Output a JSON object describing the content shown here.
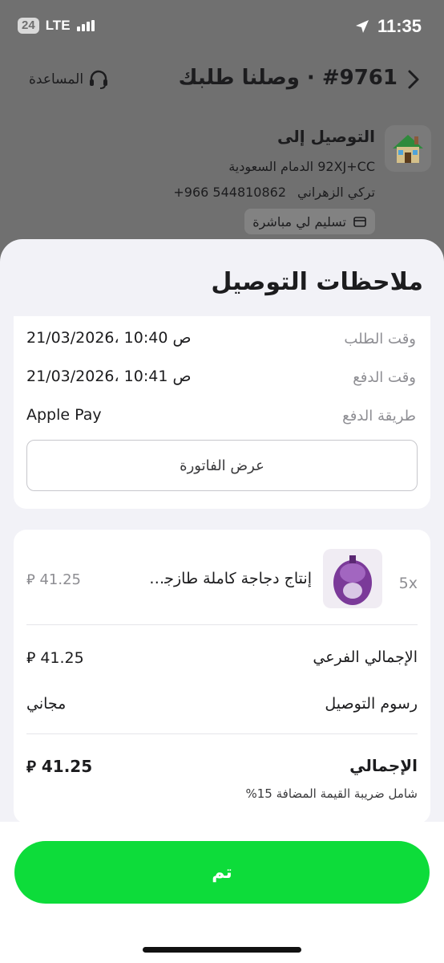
{
  "status_bar": {
    "badge": "24",
    "network": "LTE",
    "time": "11:35"
  },
  "header": {
    "title": "#9761 · وصلنا طلبك",
    "help_label": "المساعدة"
  },
  "delivery": {
    "title": "التوصيل إلى",
    "address": "92XJ+CC الدمام السعودية",
    "name": "تركي الزهراني",
    "phone": "+966 544810862",
    "chip_label": "تسليم لي مباشرة"
  },
  "sheet": {
    "title": "ملاحظات التوصيل",
    "info_rows": [
      {
        "label": "وقت الطلب",
        "value": "21/03/2026، 10:40 ص"
      },
      {
        "label": "وقت الدفع",
        "value": "21/03/2026، 10:41 ص"
      },
      {
        "label": "طريقة الدفع",
        "value": "Apple Pay"
      }
    ],
    "invoice_button": "عرض الفاتورة"
  },
  "order": {
    "item": {
      "quantity": "5x",
      "name": "إنتاج دجاجة كاملة طازجة كيس",
      "price": "41.25"
    },
    "subtotal_label": "الإجمالي الفرعي",
    "subtotal_value": "41.25",
    "delivery_fee_label": "رسوم التوصيل",
    "delivery_fee_value": "مجاني",
    "total_label": "الإجمالي",
    "total_value": "41.25",
    "vat_note": "شامل ضريبة القيمة المضافة 15%"
  },
  "footer": {
    "done_label": "تم"
  },
  "colors": {
    "accent_green": "#0ddc3a",
    "sheet_bg": "#f2f2f7",
    "muted_text": "#8e8e93"
  }
}
